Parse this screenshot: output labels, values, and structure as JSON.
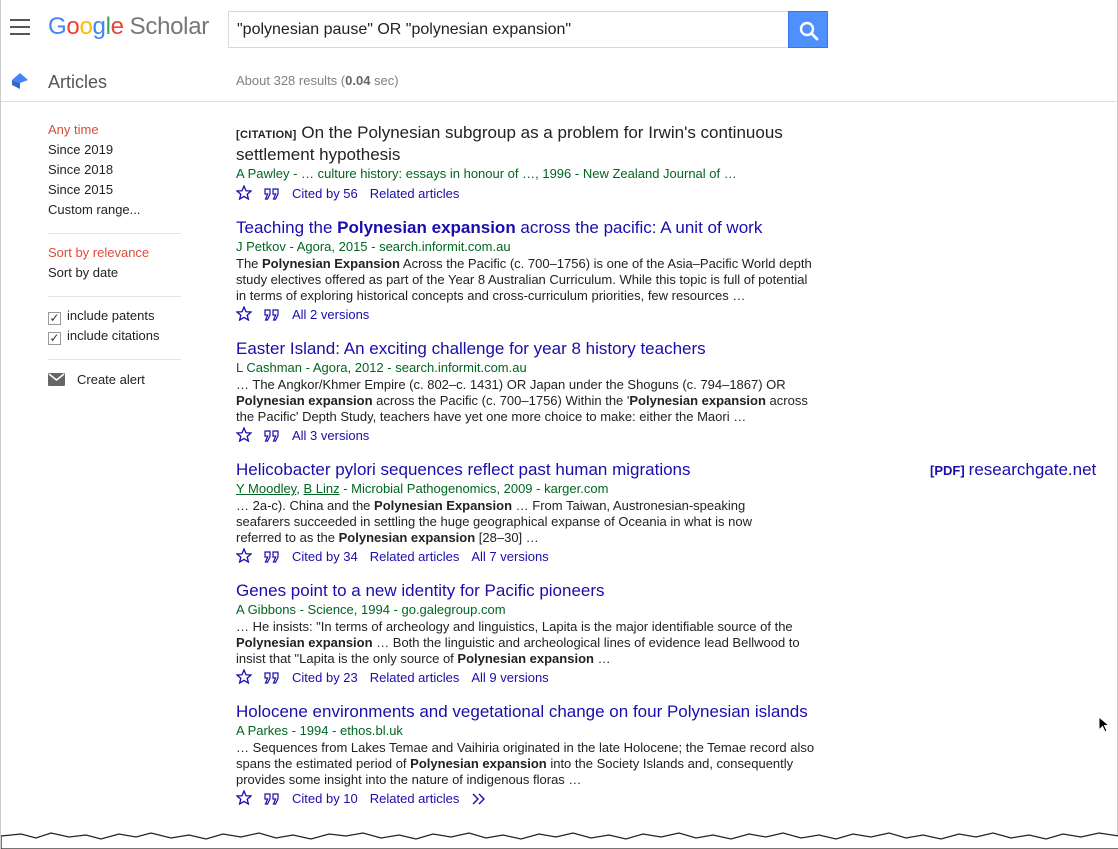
{
  "header": {
    "logo_google": [
      "G",
      "o",
      "o",
      "g",
      "l",
      "e"
    ],
    "logo_scholar": "Scholar",
    "search_query": "\"polynesian pause\" OR \"polynesian expansion\""
  },
  "subbar": {
    "section_label": "Articles",
    "results_prefix": "About 328 results (",
    "results_time": "0.04",
    "results_suffix": " sec)"
  },
  "sidebar": {
    "time_filters": [
      "Any time",
      "Since 2019",
      "Since 2018",
      "Since 2015",
      "Custom range..."
    ],
    "sort_options": [
      "Sort by relevance",
      "Sort by date"
    ],
    "include_patents": "include patents",
    "include_citations": "include citations",
    "create_alert": "Create alert"
  },
  "results": [
    {
      "tag": "[CITATION]",
      "title": "On the Polynesian subgroup as a problem for Irwin's continuous settlement hypothesis",
      "authors": "A Pawley - … culture history: essays in honour of …, 1996 - New Zealand Journal of …",
      "links": [
        "Cited by 56",
        "Related articles"
      ]
    },
    {
      "title_pre": "Teaching the ",
      "title_bold": "Polynesian expansion",
      "title_post": " across the pacific: A unit of work",
      "authors": "J Petkov - Agora, 2015 - search.informit.com.au",
      "snippet_parts": [
        "The ",
        "Polynesian Expansion",
        " Across the Pacific (c. 700–1756) is one of the Asia–Pacific World depth study electives offered as part of the Year 8 Australian Curriculum. While this topic is full of potential in terms of exploring historical concepts and cross-curriculum priorities, few resources …"
      ],
      "links": [
        "All 2 versions"
      ]
    },
    {
      "title": "Easter Island: An exciting challenge for year 8 history teachers",
      "authors": "L Cashman - Agora, 2012 - search.informit.com.au",
      "snippet_parts": [
        "… The Angkor/Khmer Empire (c. 802–c. 1431) OR Japan under the Shoguns (c. 794–1867) OR ",
        "Polynesian expansion",
        " across the Pacific (c. 700–1756) Within the '",
        "Polynesian expansion",
        " across the Pacific' Depth Study, teachers have yet one more choice to make: either the Maori …"
      ],
      "links": [
        "All 3 versions"
      ]
    },
    {
      "title": "Helicobacter pylori sequences reflect past human migrations",
      "pdf_tag": "[PDF]",
      "pdf_source": "researchgate.net",
      "author1": "Y Moodley",
      "author_sep": ", ",
      "author2": "B Linz",
      "authors_rest": " - Microbial Pathogenomics, 2009 - karger.com",
      "snippet_parts": [
        "… 2a-c). China and the ",
        "Polynesian Expansion",
        " … From Taiwan, Austronesian-speaking seafarers succeeded in settling the huge geographical expanse of Oceania in what is now referred to as the ",
        "Polynesian expansion",
        " [28–30] …"
      ],
      "links": [
        "Cited by 34",
        "Related articles",
        "All 7 versions"
      ]
    },
    {
      "title": "Genes point to a new identity for Pacific pioneers",
      "authors": "A Gibbons - Science, 1994 - go.galegroup.com",
      "snippet_parts": [
        "… He insists: \"In terms of archeology and linguistics, Lapita is the major identifiable source of the ",
        "Polynesian expansion",
        " … Both the linguistic and archeological lines of evidence lead Bellwood to insist that \"Lapita is the only source of ",
        "Polynesian expansion",
        " …"
      ],
      "links": [
        "Cited by 23",
        "Related articles",
        "All 9 versions"
      ]
    },
    {
      "title": "Holocene environments and vegetational change on four Polynesian islands",
      "authors": "A Parkes - 1994 - ethos.bl.uk",
      "snippet_parts": [
        "… Sequences from Lakes Temae and Vaihiria originated in the late Holocene; the Temae record also spans the estimated period of ",
        "Polynesian expansion",
        " into the Society Islands and, consequently provides some insight into the nature of indigenous floras …"
      ],
      "links": [
        "Cited by 10",
        "Related articles"
      ]
    }
  ],
  "colors": {
    "link": "#1a0dab",
    "green": "#006621",
    "active": "#dd4b39",
    "search_button": "#4d90fe"
  }
}
